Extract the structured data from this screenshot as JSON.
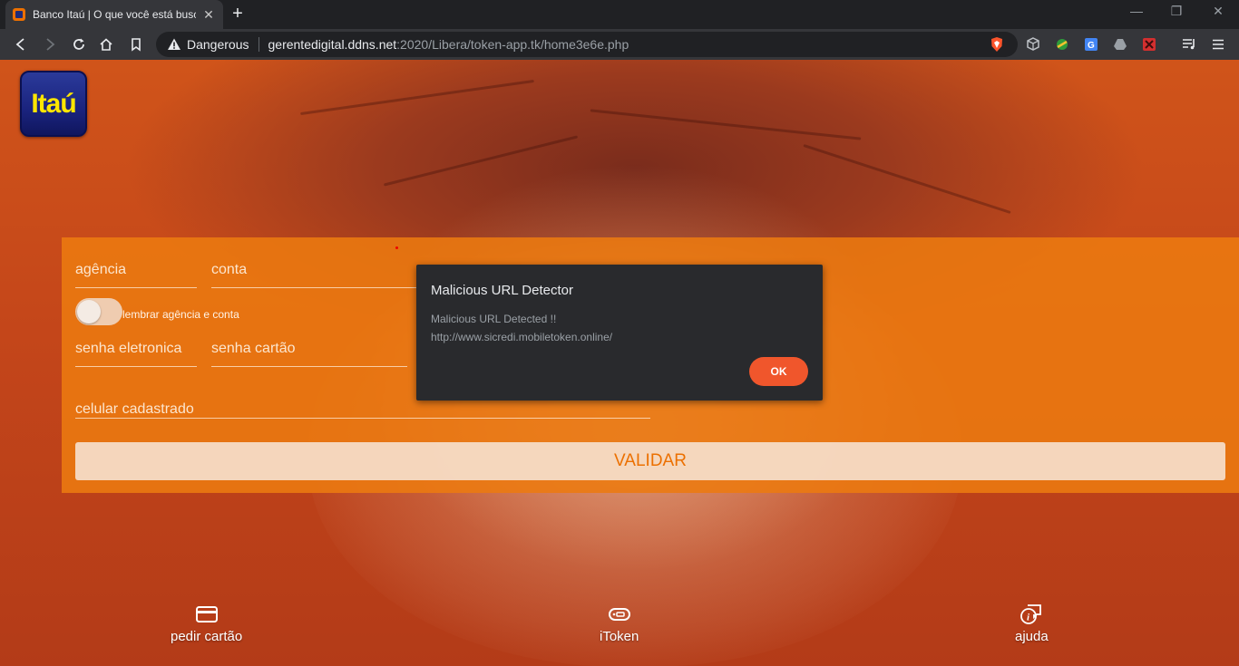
{
  "browser": {
    "tab_title": "Banco Itaú | O que você está busc",
    "tab_close": "✕",
    "new_tab": "+",
    "window_controls": {
      "minimize": "—",
      "restore": "❐",
      "close": "✕"
    },
    "security_label": "Dangerous",
    "url_host": "gerentedigital.ddns.net",
    "url_rest": ":2020/Libera/token-app.tk/home3e6e.php"
  },
  "page": {
    "logo_text": "Itaú",
    "form": {
      "agencia": "agência",
      "conta": "conta",
      "remember": "lembrar agência e conta",
      "senha_eletronica": "senha eletronica",
      "senha_cartao": "senha cartão",
      "celular": "celular cadastrado",
      "submit": "VALIDAR"
    },
    "bottom_nav": [
      {
        "label": "pedir cartão",
        "icon": "card-icon"
      },
      {
        "label": "iToken",
        "icon": "token-icon"
      },
      {
        "label": "ajuda",
        "icon": "help-chat-icon"
      }
    ],
    "colors": {
      "brand_orange": "#ec7000",
      "logo_blue": "#1a237e",
      "logo_yellow": "#ffe600"
    }
  },
  "dialog": {
    "title": "Malicious URL Detector",
    "message_line1": "Malicious URL Detected !!",
    "message_line2": "http://www.sicredi.mobiletoken.online/",
    "ok_label": "OK",
    "ok_color": "#f0562c"
  }
}
